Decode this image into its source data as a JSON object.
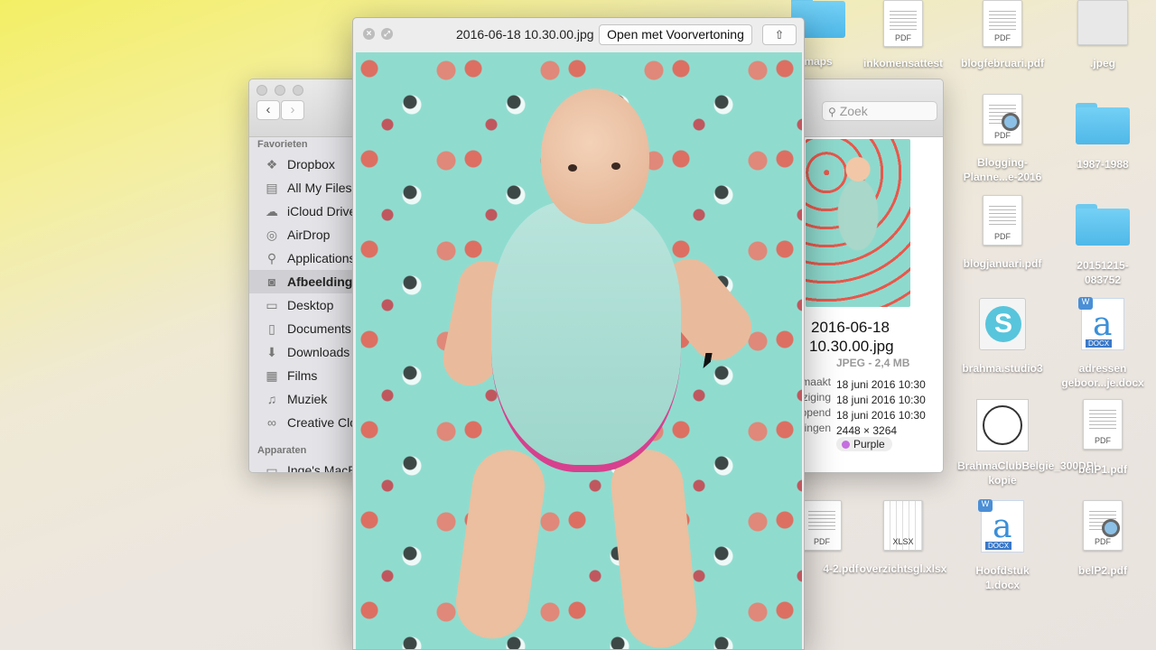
{
  "desktop": {
    "icons": [
      {
        "label": "maps",
        "kind": "folder"
      },
      {
        "label": "inkomensattest",
        "kind": "pdf"
      },
      {
        "label": "blogfebruari.pdf",
        "kind": "pdf"
      },
      {
        "label": ".jpeg",
        "kind": "image"
      },
      {
        "label": "Blogging-Planne...e-2016",
        "kind": "pdf"
      },
      {
        "label": "1987-1988",
        "kind": "folder"
      },
      {
        "label": "blogjanuari.pdf",
        "kind": "pdf"
      },
      {
        "label": "20151215-083752",
        "kind": "folder"
      },
      {
        "label": "brahma.studio3",
        "kind": "app"
      },
      {
        "label": "adressen geboor...je.docx",
        "kind": "docx"
      },
      {
        "label": "BrahmaClubBelgie_300DPI kopie",
        "kind": "image"
      },
      {
        "label": "belP1.pdf",
        "kind": "pdf"
      },
      {
        "label": "4-2.pdf",
        "kind": "pdf"
      },
      {
        "label": "overzichtsgl.xlsx",
        "kind": "xlsx"
      },
      {
        "label": "Hoofdstuk 1.docx",
        "kind": "docx"
      },
      {
        "label": "belP2.pdf",
        "kind": "pdf"
      }
    ],
    "tags": {
      "pdf": "PDF",
      "xlsx": "XLSX",
      "docx": "DOCX"
    }
  },
  "finder": {
    "search_placeholder": "Zoek",
    "sidebar": {
      "favorites_header": "Favorieten",
      "devices_header": "Apparaten",
      "items": [
        {
          "label": "Dropbox",
          "icon": "dropbox-icon",
          "glyph": "❖"
        },
        {
          "label": "All My Files",
          "icon": "all-files-icon",
          "glyph": "▤"
        },
        {
          "label": "iCloud Drive",
          "icon": "cloud-icon",
          "glyph": "☁"
        },
        {
          "label": "AirDrop",
          "icon": "airdrop-icon",
          "glyph": "◎"
        },
        {
          "label": "Applications",
          "icon": "applications-icon",
          "glyph": "⚲"
        },
        {
          "label": "Afbeeldingen",
          "icon": "camera-icon",
          "glyph": "◙"
        },
        {
          "label": "Desktop",
          "icon": "desktop-icon",
          "glyph": "▭"
        },
        {
          "label": "Documents",
          "icon": "documents-icon",
          "glyph": "▯"
        },
        {
          "label": "Downloads",
          "icon": "downloads-icon",
          "glyph": "⬇"
        },
        {
          "label": "Films",
          "icon": "film-icon",
          "glyph": "▦"
        },
        {
          "label": "Muziek",
          "icon": "music-icon",
          "glyph": "♫"
        },
        {
          "label": "Creative Cloud",
          "icon": "creative-cloud-icon",
          "glyph": "∞"
        }
      ],
      "device": "Inge's MacBook"
    },
    "preview": {
      "name_line1": "2016-06-18",
      "name_line2": "10.30.00.jpg",
      "type_size": "JPEG - 2,4 MB",
      "rows": [
        {
          "key": "Aangemaakt",
          "value": "18 juni 2016 10:30"
        },
        {
          "key": "Wijziging",
          "value": "18 juni 2016 10:30"
        },
        {
          "key": "Laatst geopend",
          "value": "18 juni 2016 10:30"
        },
        {
          "key": "Afmetingen",
          "value": "2448 × 3264"
        }
      ],
      "tag": "Purple",
      "tag_color": "#c56fe0"
    }
  },
  "quicklook": {
    "filename": "2016-06-18 10.30.00.jpg",
    "open_button": "Open met Voorvertoning",
    "share_glyph": "⇧"
  }
}
